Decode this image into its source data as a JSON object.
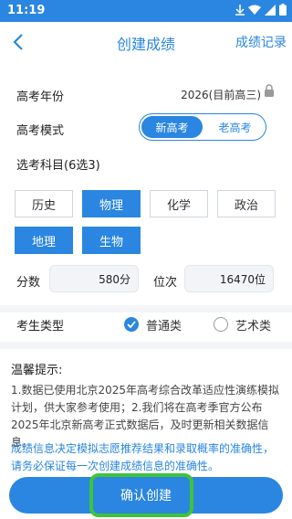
{
  "status": {
    "time": "11:19"
  },
  "header": {
    "title": "创建成绩",
    "record": "成绩记录"
  },
  "form": {
    "year_label": "高考年份",
    "year_value": "2026(目前高三)",
    "mode_label": "高考模式",
    "mode_options": [
      "新高考",
      "老高考"
    ],
    "subjects_label": "选考科目(6选3)",
    "subjects": [
      "历史",
      "物理",
      "化学",
      "政治",
      "地理",
      "生物"
    ],
    "score_label": "分数",
    "score_value": "580分",
    "rank_label": "位次",
    "rank_value": "16470位",
    "type_label": "考生类型",
    "type_options": [
      "普通类",
      "艺术类"
    ]
  },
  "tips": {
    "title": "温馨提示:",
    "text": "1.数据已使用北京2025年高考综合改革适应性演练模拟计划，供大家参考使用；2.我们将在高考季官方公布2025年北京新高考正式数据后，及时更新相关数据信息。",
    "warning": "成绩信息决定模拟志愿推荐结果和录取概率的准确性，请务必保证每一次创建成绩信息的准确性。"
  },
  "confirm_label": "确认创建"
}
